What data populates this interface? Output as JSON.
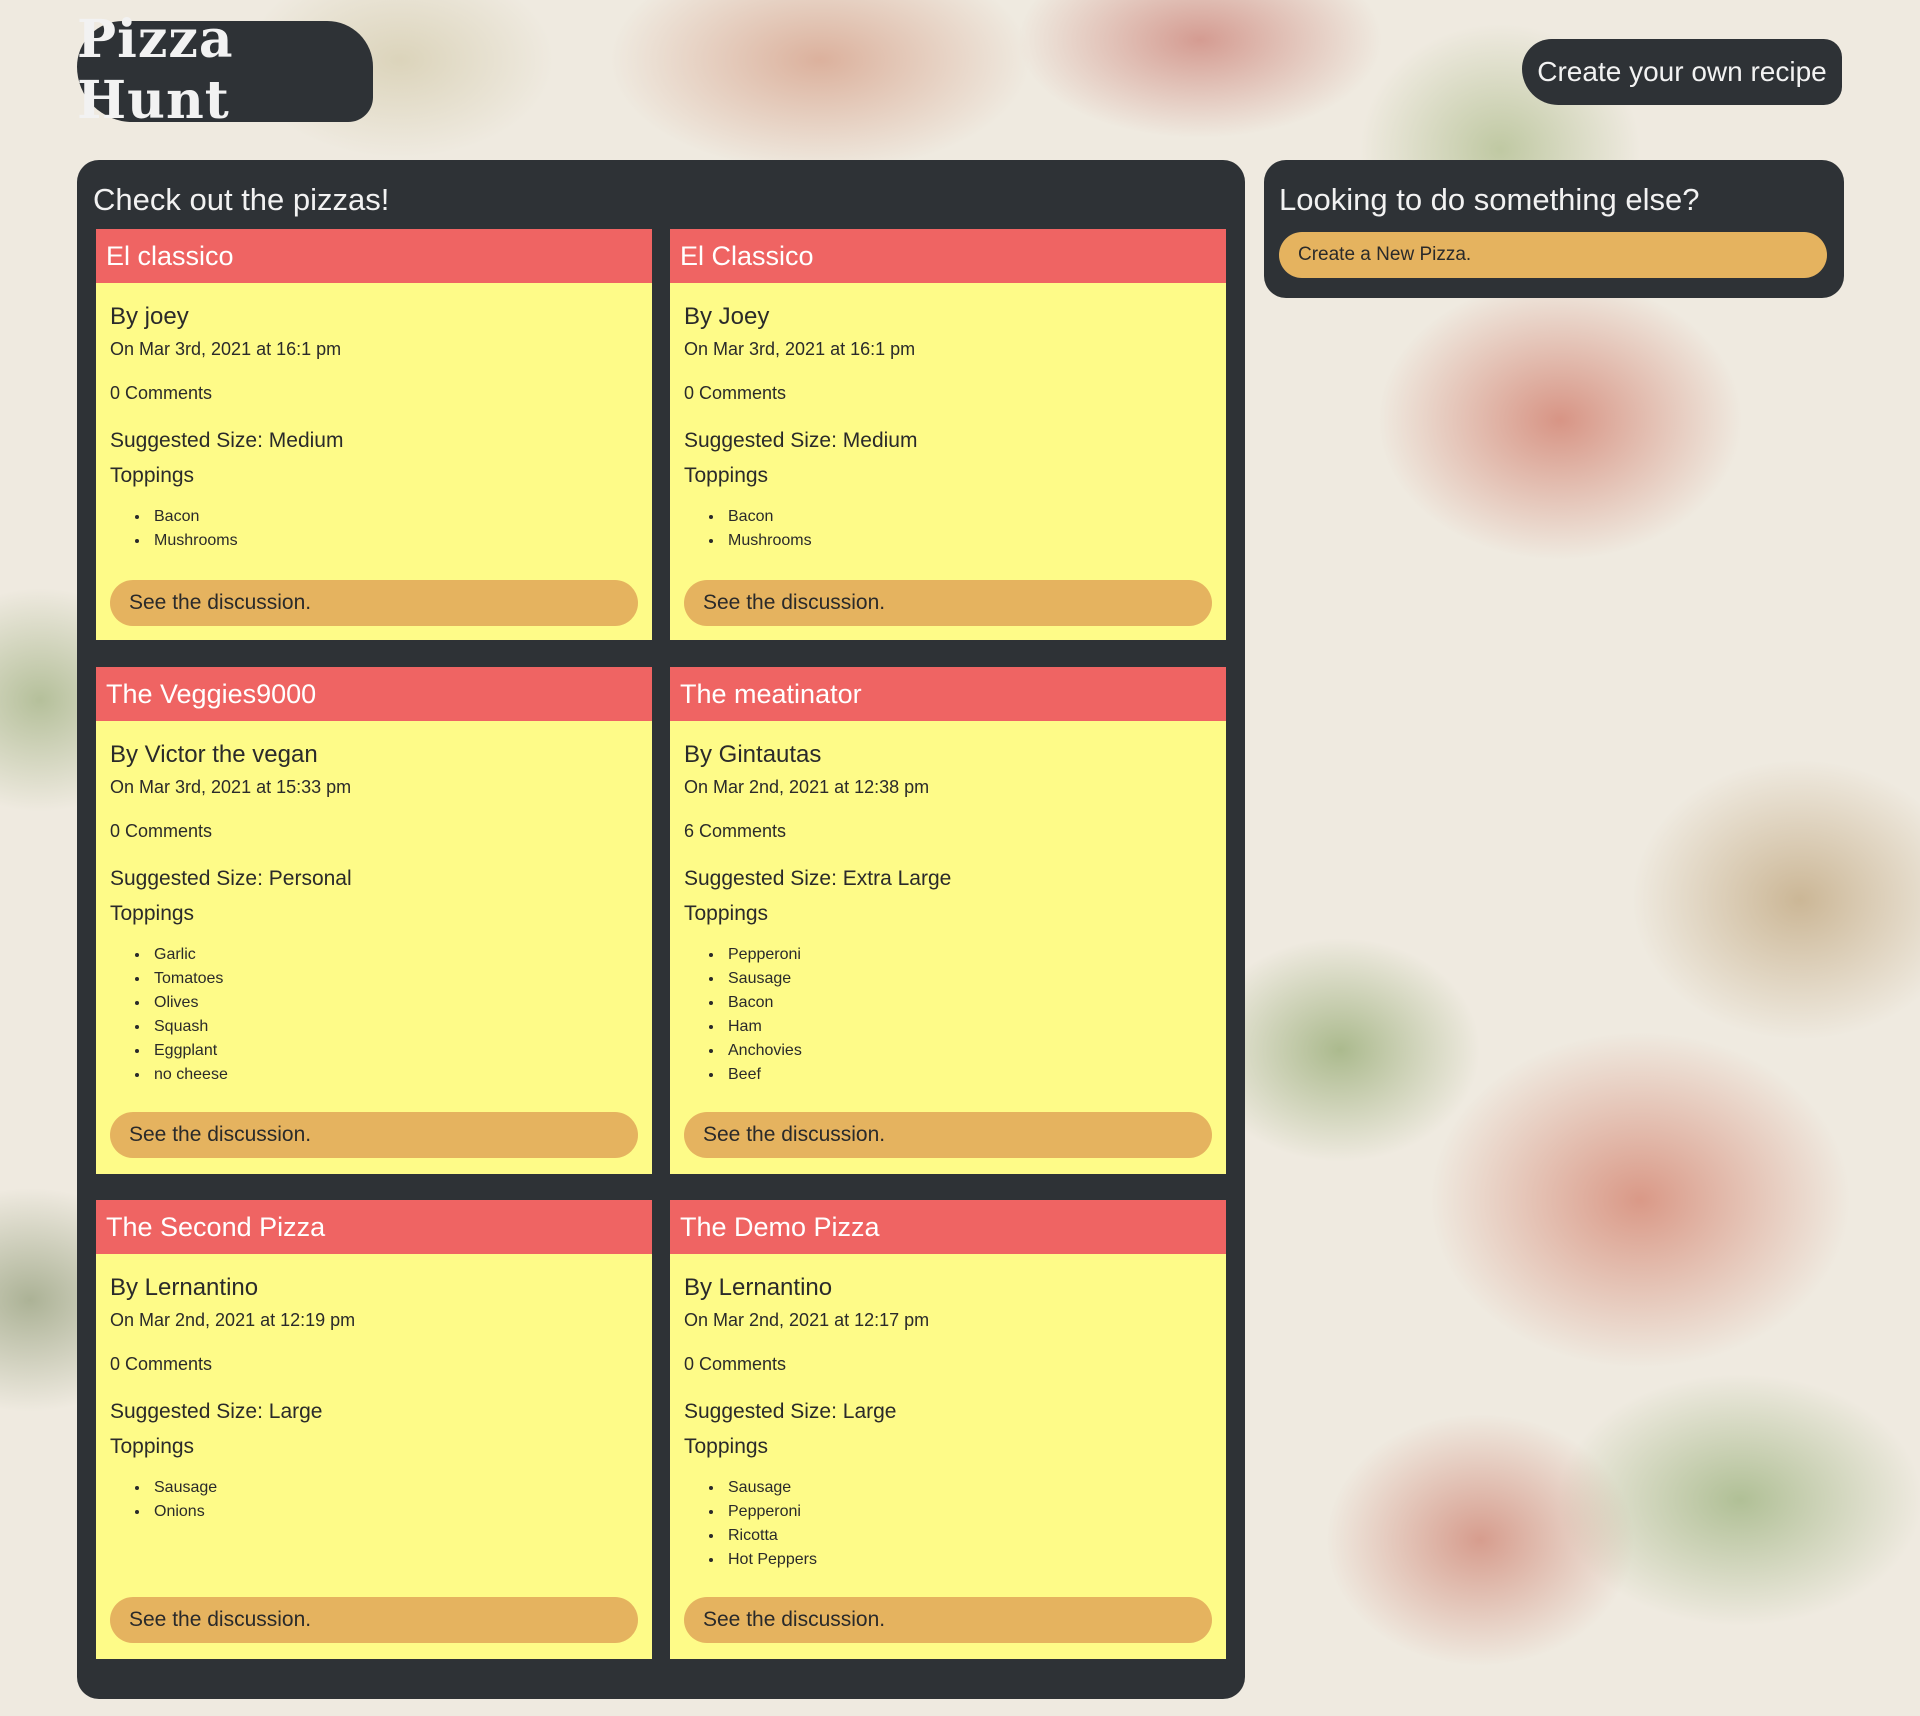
{
  "header": {
    "logo": "Pizza Hunt",
    "create_recipe_label": "Create your own recipe"
  },
  "main": {
    "title": "Check out the pizzas!",
    "pizzas": [
      {
        "name": "El classico",
        "author": "By joey",
        "date": "On Mar 3rd, 2021 at 16:1 pm",
        "comments": "0 Comments",
        "size": "Suggested Size: Medium",
        "toppings_label": "Toppings",
        "toppings": [
          "Bacon",
          "Mushrooms"
        ],
        "discussion_label": "See the discussion."
      },
      {
        "name": "El Classico",
        "author": "By Joey",
        "date": "On Mar 3rd, 2021 at 16:1 pm",
        "comments": "0 Comments",
        "size": "Suggested Size: Medium",
        "toppings_label": "Toppings",
        "toppings": [
          "Bacon",
          "Mushrooms"
        ],
        "discussion_label": "See the discussion."
      },
      {
        "name": "The Veggies9000",
        "author": "By Victor the vegan",
        "date": "On Mar 3rd, 2021 at 15:33 pm",
        "comments": "0 Comments",
        "size": "Suggested Size: Personal",
        "toppings_label": "Toppings",
        "toppings": [
          "Garlic",
          "Tomatoes",
          "Olives",
          "Squash",
          "Eggplant",
          "no cheese"
        ],
        "discussion_label": "See the discussion."
      },
      {
        "name": "The meatinator",
        "author": "By Gintautas",
        "date": "On Mar 2nd, 2021 at 12:38 pm",
        "comments": "6 Comments",
        "size": "Suggested Size: Extra Large",
        "toppings_label": "Toppings",
        "toppings": [
          "Pepperoni",
          "Sausage",
          "Bacon",
          "Ham",
          "Anchovies",
          "Beef"
        ],
        "discussion_label": "See the discussion."
      },
      {
        "name": "The Second Pizza",
        "author": "By Lernantino",
        "date": "On Mar 2nd, 2021 at 12:19 pm",
        "comments": "0 Comments",
        "size": "Suggested Size: Large",
        "toppings_label": "Toppings",
        "toppings": [
          "Sausage",
          "Onions"
        ],
        "discussion_label": "See the discussion."
      },
      {
        "name": "The Demo Pizza",
        "author": "By Lernantino",
        "date": "On Mar 2nd, 2021 at 12:17 pm",
        "comments": "0 Comments",
        "size": "Suggested Size: Large",
        "toppings_label": "Toppings",
        "toppings": [
          "Sausage",
          "Pepperoni",
          "Ricotta",
          "Hot Peppers"
        ],
        "discussion_label": "See the discussion."
      }
    ]
  },
  "sidebar": {
    "title": "Looking to do something else?",
    "new_pizza_label": "Create a New Pizza."
  },
  "colors": {
    "panel": "#2e3236",
    "card_header": "#ef6463",
    "card_body": "#fefb88",
    "button": "#e5b35f"
  }
}
